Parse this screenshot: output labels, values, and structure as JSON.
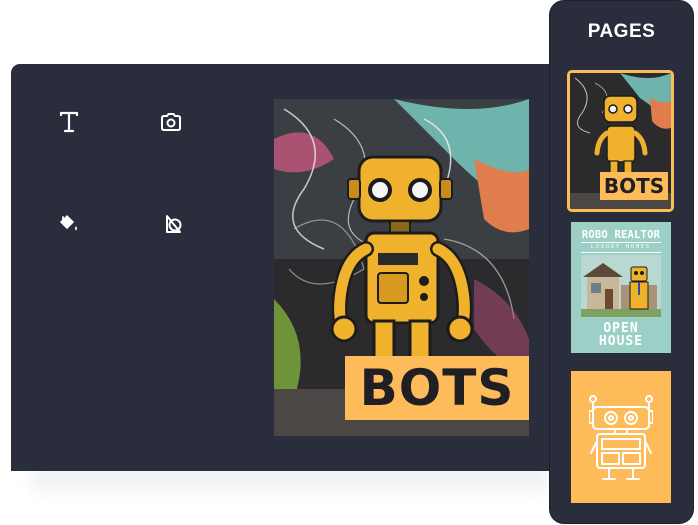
{
  "editor": {
    "tools": [
      {
        "name": "text-tool",
        "icon": "text-icon"
      },
      {
        "name": "photo-tool",
        "icon": "camera-icon"
      },
      {
        "name": "fill-tool",
        "icon": "paint-bucket-icon"
      },
      {
        "name": "shapes-tool",
        "icon": "shapes-icon"
      }
    ],
    "canvas": {
      "title": "BOTS",
      "image": "robot-graffiti-poster",
      "title_bg": "#fdbb5a"
    }
  },
  "pages_panel": {
    "title": "PAGES",
    "pages": [
      {
        "title": "BOTS",
        "selected": true,
        "image": "robot-graffiti-thumbnail"
      },
      {
        "heading": "ROBO REALTOR",
        "subheading": "LUXURY HOMES",
        "footer_line1": "OPEN",
        "footer_line2": "HOUSE",
        "bg": "#9ccfc6",
        "image": "robot-house-thumbnail"
      },
      {
        "image": "robot-line-icon",
        "bg": "#fdbb5a"
      }
    ]
  },
  "colors": {
    "panel_bg": "#292d3c",
    "accent": "#fdbb5a",
    "text": "#ffffff"
  }
}
